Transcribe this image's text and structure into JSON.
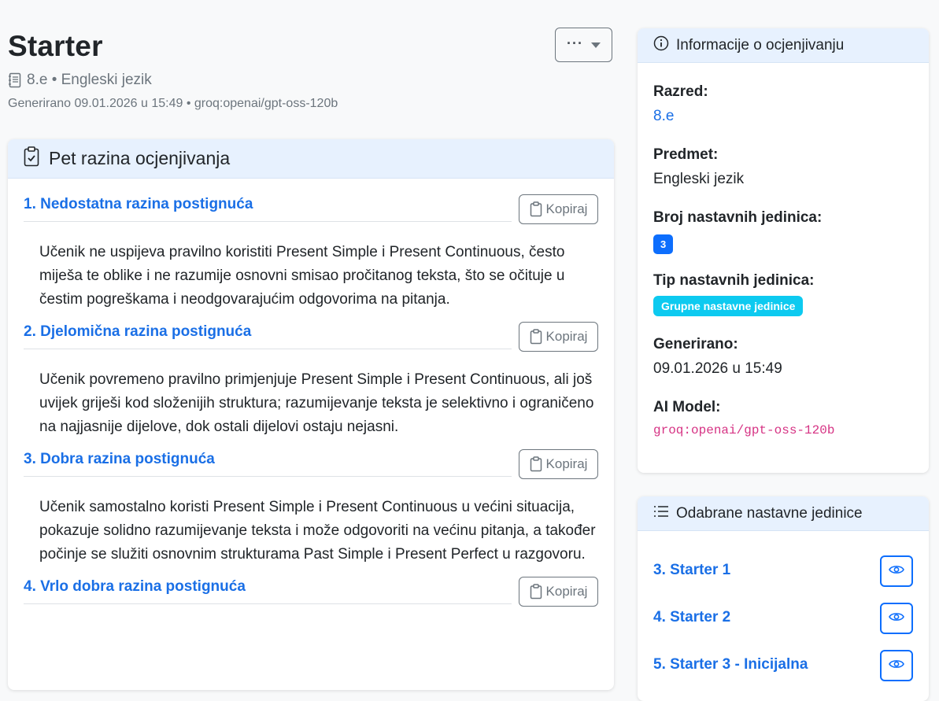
{
  "header": {
    "title": "Starter",
    "subtitle": "8.e • Engleski jezik",
    "meta": "Generirano 09.01.2026 u 15:49 • groq:openai/gpt-oss-120b",
    "more_button": "···"
  },
  "levels_card": {
    "title": "Pet razina ocjenjivanja",
    "copy_label": "Kopiraj",
    "levels": [
      {
        "title": "1. Nedostatna razina postignuća",
        "text": "Učenik ne uspijeva pravilno koristiti Present Simple i Present Continuous, često miješa te oblike i ne razumije osnovni smisao pročitanog teksta, što se očituje u čestim pogreškama i neodgovarajućim odgovorima na pitanja."
      },
      {
        "title": "2. Djelomična razina postignuća",
        "text": "Učenik povremeno pravilno primjenjuje Present Simple i Present Continuous, ali još uvijek griješi kod složenijih struktura; razumijevanje teksta je selektivno i ograničeno na najjasnije dijelove, dok ostali dijelovi ostaju nejasni."
      },
      {
        "title": "3. Dobra razina postignuća",
        "text": "Učenik samostalno koristi Present Simple i Present Continuous u većini situacija, pokazuje solidno razumijevanje teksta i može odgovoriti na većinu pitanja, a također počinje se služiti osnovnim strukturama Past Simple i Present Perfect u razgovoru."
      },
      {
        "title": "4. Vrlo dobra razina postignuća",
        "text": ""
      }
    ]
  },
  "info_card": {
    "title": "Informacije o ocjenjivanju",
    "class_label": "Razred:",
    "class_value": "8.e",
    "subject_label": "Predmet:",
    "subject_value": "Engleski jezik",
    "units_count_label": "Broj nastavnih jedinica:",
    "units_count_value": "3",
    "units_type_label": "Tip nastavnih jedinica:",
    "units_type_value": "Grupne nastavne jedinice",
    "generated_label": "Generirano:",
    "generated_value": "09.01.2026 u 15:49",
    "model_label": "AI Model:",
    "model_value": "groq:openai/gpt-oss-120b"
  },
  "units_card": {
    "title": "Odabrane nastavne jedinice",
    "items": [
      {
        "label": "3. Starter 1"
      },
      {
        "label": "4. Starter 2"
      },
      {
        "label": "5. Starter 3 - Inicijalna"
      }
    ]
  },
  "colors": {
    "accent": "#0d6efd",
    "link": "#1a6fe6",
    "header_bg": "#e7f1fe",
    "badge_info": "#0dcaf0",
    "code": "#d63384"
  }
}
